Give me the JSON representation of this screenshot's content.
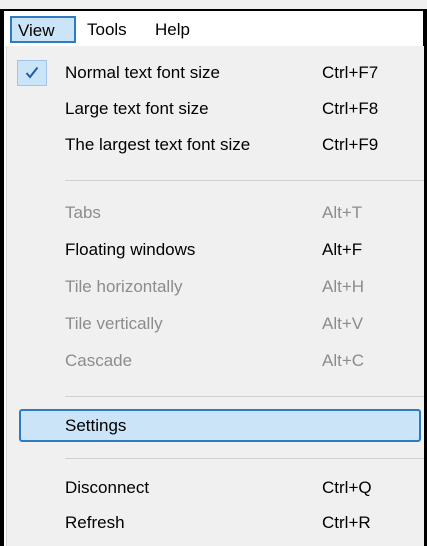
{
  "menubar": {
    "view": "View",
    "tools": "Tools",
    "help": "Help"
  },
  "menu": {
    "normal": {
      "label": "Normal text font size",
      "shortcut": "Ctrl+F7",
      "checked": true
    },
    "large": {
      "label": "Large text font size",
      "shortcut": "Ctrl+F8"
    },
    "largest": {
      "label": "The largest text font size",
      "shortcut": "Ctrl+F9"
    },
    "tabs": {
      "label": "Tabs",
      "shortcut": "Alt+T",
      "disabled": true
    },
    "floating": {
      "label": "Floating windows",
      "shortcut": "Alt+F"
    },
    "tile_h": {
      "label": "Tile horizontally",
      "shortcut": "Alt+H",
      "disabled": true
    },
    "tile_v": {
      "label": "Tile vertically",
      "shortcut": "Alt+V",
      "disabled": true
    },
    "cascade": {
      "label": "Cascade",
      "shortcut": "Alt+C",
      "disabled": true
    },
    "settings": {
      "label": "Settings",
      "highlighted": true
    },
    "disconnect": {
      "label": "Disconnect",
      "shortcut": "Ctrl+Q"
    },
    "refresh": {
      "label": "Refresh",
      "shortcut": "Ctrl+R"
    }
  },
  "icons": {
    "checkmark": "check-icon"
  },
  "colors": {
    "highlight_fill": "#cce4f7",
    "highlight_border": "#2d7bc1",
    "menu_bg": "#f0f0f0",
    "disabled_text": "#8c8c8c"
  }
}
